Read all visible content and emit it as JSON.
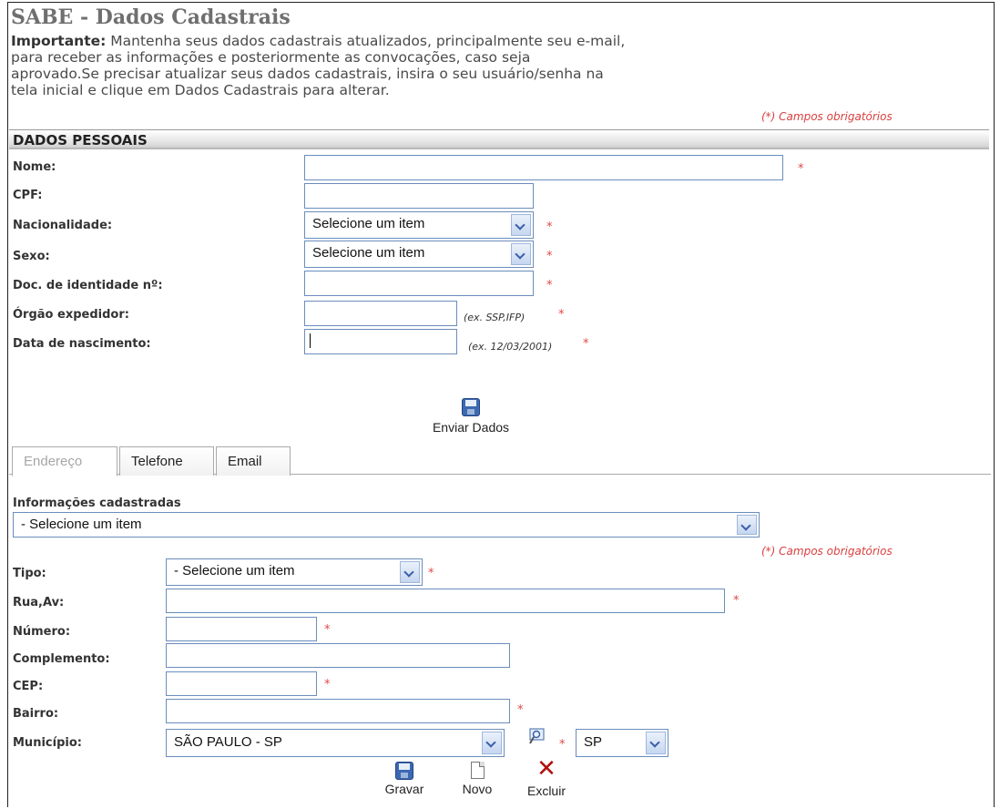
{
  "header": {
    "title": "SABE - Dados Cadastrais",
    "intro_bold": "Importante:",
    "intro_lines": [
      " Mantenha seus dados cadastrais atualizados, principalmente seu e-mail,",
      "para receber as informações e posteriormente as convocações, caso seja",
      "aprovado.Se precisar atualizar seus dados cadastrais, insira o seu usuário/senha na",
      "tela inicial e clique em Dados Cadastrais para alterar."
    ],
    "required_note": "(*) Campos obrigatórios"
  },
  "personal": {
    "section_title": "DADOS PESSOAIS",
    "fields": {
      "nome": {
        "label": "Nome:",
        "value": ""
      },
      "cpf": {
        "label": "CPF:",
        "value": ""
      },
      "nacionalidade": {
        "label": "Nacionalidade:",
        "selected": "Selecione um item"
      },
      "sexo": {
        "label": "Sexo:",
        "selected": "Selecione um item"
      },
      "doc": {
        "label": "Doc. de identidade nº:",
        "value": ""
      },
      "orgao": {
        "label": "Órgão expedidor:",
        "value": "",
        "hint": "(ex. SSP,IFP)"
      },
      "nascimento": {
        "label": "Data de nascimento:",
        "value": "",
        "hint": "(ex. 12/03/2001)"
      }
    },
    "required_mark": "*",
    "submit_label": "Enviar Dados"
  },
  "tabs": [
    {
      "label": "Endereço",
      "active": true
    },
    {
      "label": "Telefone",
      "active": false
    },
    {
      "label": "Email",
      "active": false
    }
  ],
  "address": {
    "registered_label": "Informações cadastradas",
    "registered_selected": "- Selecione um item",
    "required_note": "(*) Campos obrigatórios",
    "fields": {
      "tipo": {
        "label": "Tipo:",
        "selected": "- Selecione um item"
      },
      "rua": {
        "label": "Rua,Av:",
        "value": ""
      },
      "numero": {
        "label": "Número:",
        "value": ""
      },
      "complemento": {
        "label": "Complemento:",
        "value": ""
      },
      "cep": {
        "label": "CEP:",
        "value": ""
      },
      "bairro": {
        "label": "Bairro:",
        "value": ""
      },
      "municipio": {
        "label": "Município:",
        "selected": "SÃO PAULO - SP",
        "uf_selected": "SP"
      }
    },
    "actions": {
      "save": "Gravar",
      "new": "Novo",
      "delete": "Excluir"
    }
  },
  "colors": {
    "accent_border": "#6b8dbd",
    "required": "#e04848"
  }
}
